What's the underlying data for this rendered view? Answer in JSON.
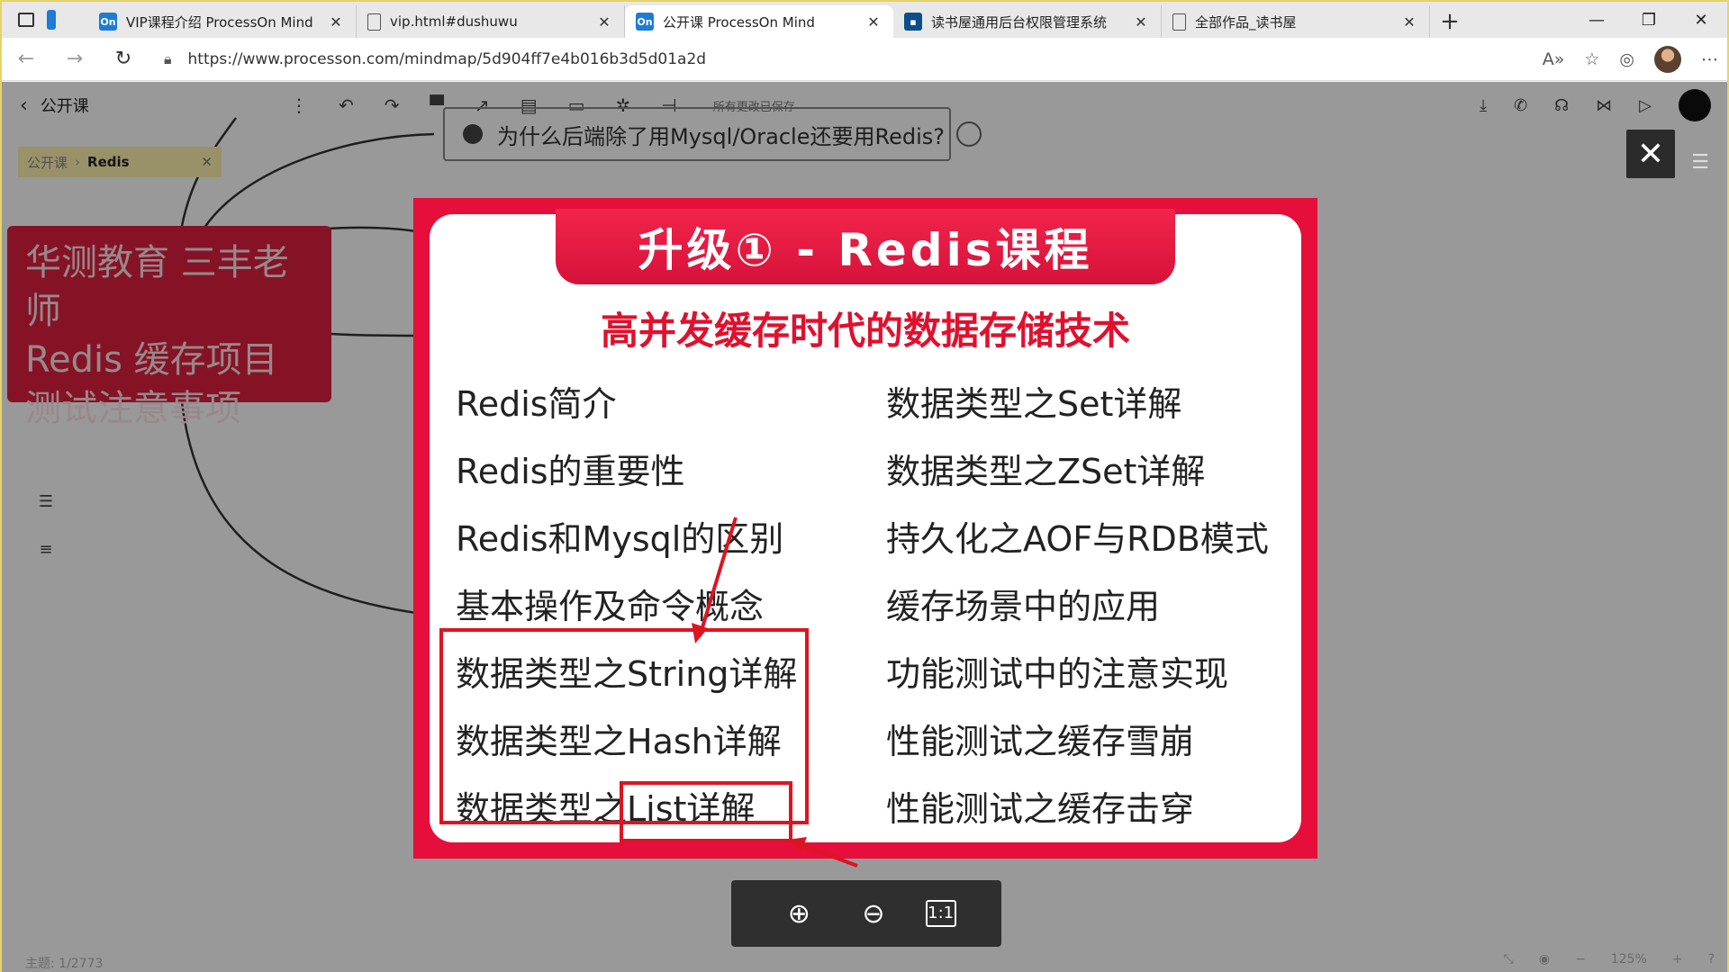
{
  "browser": {
    "tabs": [
      {
        "title": "VIP课程介绍 ProcessOn Mind",
        "icon": "processon",
        "active": false
      },
      {
        "title": "vip.html#dushuwu",
        "icon": "document",
        "active": false
      },
      {
        "title": "公开课 ProcessOn Mind",
        "icon": "processon",
        "active": true
      },
      {
        "title": "读书屋通用后台权限管理系统",
        "icon": "thinkphp",
        "active": false
      },
      {
        "title": "全部作品_读书屋",
        "icon": "document",
        "active": false
      }
    ],
    "favicon_on": "On",
    "new_tab": "+",
    "url": "https://www.processon.com/mindmap/5d904ff7e4b016b3d5d01a2d"
  },
  "app": {
    "doc_name": "公开课",
    "saved_text": "所有更改已保存",
    "breadcrumb": {
      "parent": "公开课",
      "current": "Redis"
    },
    "topic_pill": "为什么后端除了用Mysql/Oracle还要用Redis?",
    "central_node": "华测教育 三丰老师\nRedis 缓存项目\n测试注意事项",
    "status_left": "主题: 1/2773",
    "zoom_level": "125%"
  },
  "preview": {
    "banner": "升级① - Redis课程",
    "subtitle": "高并发缓存时代的数据存储技术",
    "left_items": [
      "Redis简介",
      "Redis的重要性",
      "Redis和Mysql的区别",
      "基本操作及命令概念",
      "数据类型之String详解",
      "数据类型之Hash详解",
      "数据类型之List详解"
    ],
    "right_items": [
      "数据类型之Set详解",
      "数据类型之ZSet详解",
      "持久化之AOF与RDB模式",
      "缓存场景中的应用",
      "功能测试中的注意实现",
      "性能测试之缓存雪崩",
      "性能测试之缓存击穿"
    ],
    "zoom_one_to_one": "1:1"
  },
  "colors": {
    "brand_red": "#e60e3a",
    "annotation_red": "#dd1422",
    "node_red": "#e0203e"
  }
}
